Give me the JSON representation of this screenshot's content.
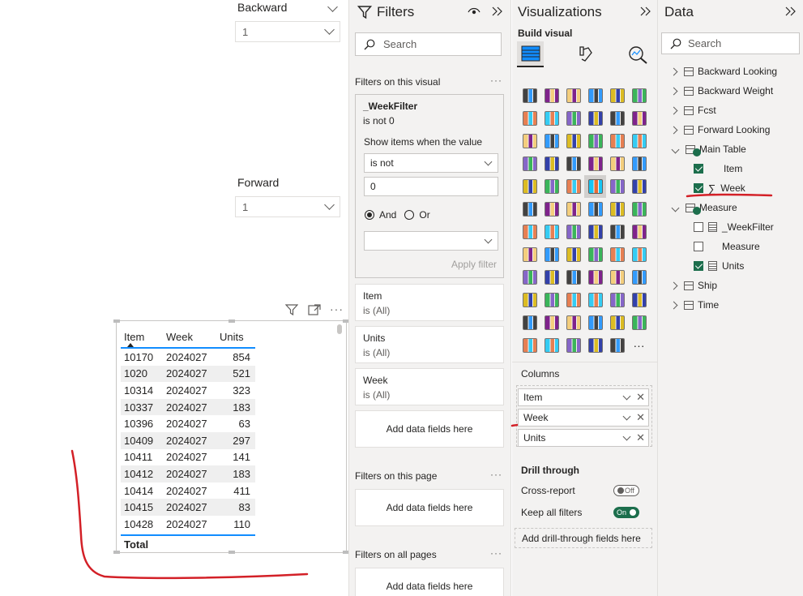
{
  "slicers": {
    "backward": {
      "title": "Backward",
      "value": "1"
    },
    "forward": {
      "title": "Forward",
      "value": "1"
    }
  },
  "table": {
    "headers": [
      "Item",
      "Week",
      "Units"
    ],
    "rows": [
      [
        "10170",
        "2024027",
        "854"
      ],
      [
        "1020",
        "2024027",
        "521"
      ],
      [
        "10314",
        "2024027",
        "323"
      ],
      [
        "10337",
        "2024027",
        "183"
      ],
      [
        "10396",
        "2024027",
        "63"
      ],
      [
        "10409",
        "2024027",
        "297"
      ],
      [
        "10411",
        "2024027",
        "141"
      ],
      [
        "10412",
        "2024027",
        "183"
      ],
      [
        "10414",
        "2024027",
        "411"
      ],
      [
        "10415",
        "2024027",
        "83"
      ],
      [
        "10428",
        "2024027",
        "110"
      ]
    ],
    "total_label": "Total"
  },
  "filters": {
    "title": "Filters",
    "search_placeholder": "Search",
    "on_visual_label": "Filters on this visual",
    "dots": "···",
    "weekfilter": {
      "name": "_WeekFilter",
      "summary": "is not 0",
      "show_label": "Show items when the value",
      "operator": "is not",
      "value": "0",
      "and_label": "And",
      "or_label": "Or",
      "apply_label": "Apply filter"
    },
    "cards": [
      {
        "name": "Item",
        "state": "is (All)"
      },
      {
        "name": "Units",
        "state": "is (All)"
      },
      {
        "name": "Week",
        "state": "is (All)"
      }
    ],
    "add_fields": "Add data fields here",
    "on_page_label": "Filters on this page",
    "on_all_label": "Filters on all pages"
  },
  "viz": {
    "title": "Visualizations",
    "build_label": "Build visual",
    "columns_label": "Columns",
    "columns": [
      "Item",
      "Week",
      "Units"
    ],
    "drill_label": "Drill through",
    "cross_report": "Cross-report",
    "cross_toggle": "Off",
    "keep_filters": "Keep all filters",
    "keep_toggle": "On",
    "add_drill": "Add drill-through fields here",
    "more": "···"
  },
  "data_pane": {
    "title": "Data",
    "search_placeholder": "Search",
    "tables": [
      {
        "name": "Backward Looking"
      },
      {
        "name": "Backward Weight"
      },
      {
        "name": "Fcst"
      },
      {
        "name": "Forward Looking"
      },
      {
        "name": "Main Table"
      },
      {
        "name": "Measure"
      },
      {
        "name": "Ship"
      },
      {
        "name": "Time"
      }
    ],
    "main_fields": [
      {
        "name": "Item",
        "checked": true
      },
      {
        "name": "Week",
        "checked": true,
        "sigma": "∑"
      }
    ],
    "measure_fields": [
      {
        "name": "_WeekFilter",
        "checked": false
      },
      {
        "name": "Measure",
        "checked": false
      },
      {
        "name": "Units",
        "checked": true
      }
    ]
  },
  "colors": {
    "accent": "#118dff",
    "annotation": "#d32027",
    "check": "#1c6e4c"
  }
}
